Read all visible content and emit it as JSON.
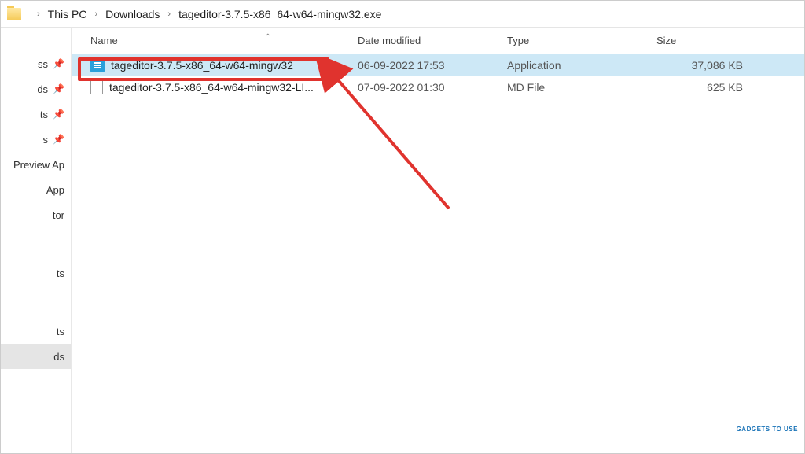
{
  "breadcrumb": {
    "items": [
      "This PC",
      "Downloads",
      "tageditor-3.7.5-x86_64-w64-mingw32.exe"
    ]
  },
  "sidebar": {
    "items": [
      {
        "label": "ss",
        "pinned": true
      },
      {
        "label": "ds",
        "pinned": true
      },
      {
        "label": "ts",
        "pinned": true
      },
      {
        "label": "s",
        "pinned": true
      },
      {
        "label": "Preview Ap",
        "pinned": false
      },
      {
        "label": "App",
        "pinned": false
      },
      {
        "label": "tor",
        "pinned": false
      },
      {
        "label": "",
        "pinned": false
      },
      {
        "label": "",
        "pinned": false
      },
      {
        "label": "ts",
        "pinned": false
      },
      {
        "label": "",
        "pinned": false
      },
      {
        "label": "ts",
        "pinned": false
      },
      {
        "label": "ds",
        "pinned": false,
        "selected": true
      }
    ]
  },
  "columns": {
    "name": "Name",
    "modified": "Date modified",
    "type": "Type",
    "size": "Size"
  },
  "files": [
    {
      "name": "tageditor-3.7.5-x86_64-w64-mingw32",
      "modified": "06-09-2022 17:53",
      "type": "Application",
      "size": "37,086 KB",
      "icon": "app",
      "selected": true
    },
    {
      "name": "tageditor-3.7.5-x86_64-w64-mingw32-LI...",
      "modified": "07-09-2022 01:30",
      "type": "MD File",
      "size": "625 KB",
      "icon": "doc",
      "selected": false
    }
  ],
  "annotation": {
    "highlight_file_index": 0
  },
  "watermark": "GADGETS TO USE"
}
